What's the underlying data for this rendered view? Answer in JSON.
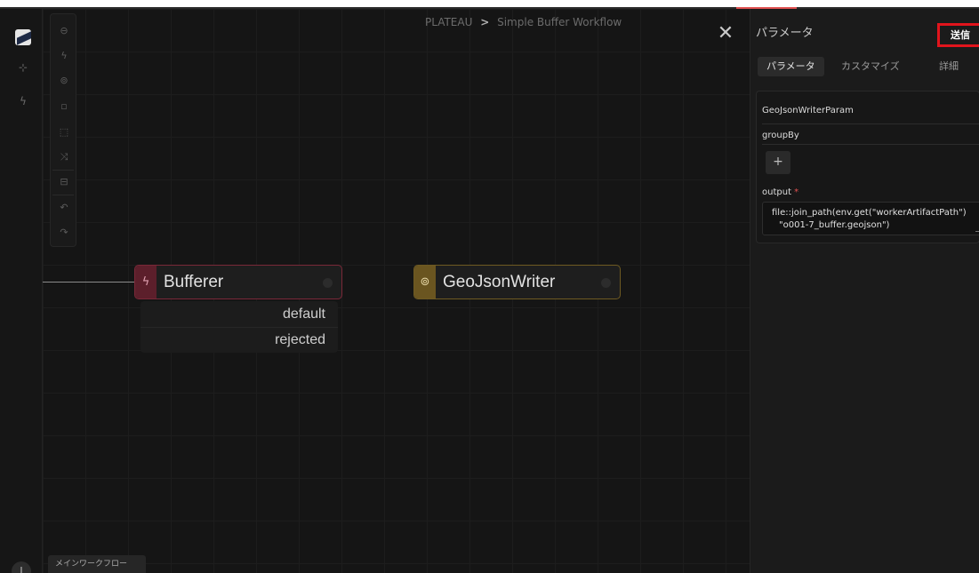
{
  "colors": {
    "background": "#141414",
    "panel": "#1b1b1b",
    "submit_outline": "#e1141c",
    "bufferer_accent": "#7a2838",
    "writer_accent": "#6e5a22",
    "active_indicator": "#e05151"
  },
  "sidebar": {
    "items": [
      {
        "icon": "layer-tree-icon"
      },
      {
        "icon": "lightning-icon"
      }
    ],
    "user_initial": "J"
  },
  "canvas_toolbar": {
    "items": [
      {
        "icon": "reader-icon"
      },
      {
        "icon": "transformer-icon"
      },
      {
        "icon": "writer-icon"
      },
      {
        "icon": "note-icon"
      },
      {
        "icon": "batch-icon"
      },
      {
        "icon": "subworkflow-icon"
      },
      {
        "icon": "layout-icon"
      },
      {
        "icon": "undo-icon"
      },
      {
        "icon": "redo-icon"
      }
    ]
  },
  "breadcrumb": {
    "project": "PLATEAU",
    "separator": ">",
    "workflow": "Simple Buffer Workflow"
  },
  "nodes": {
    "bufferer": {
      "icon": "lightning-icon",
      "label": "Bufferer",
      "ports": [
        "default",
        "rejected"
      ]
    },
    "geojson_writer": {
      "icon": "disc-icon",
      "label": "GeoJsonWriter"
    }
  },
  "workflow_tab": "メインワークフロー",
  "panel": {
    "title": "パラメータ",
    "submit_label": "送信",
    "tabs": [
      "パラメータ",
      "カスタマイズ",
      "詳細"
    ],
    "active_tab": "パラメータ",
    "form": {
      "schema_title": "GeoJsonWriterParam",
      "group_by_label": "groupBy",
      "add_label": "+",
      "output_label": "output",
      "required_mark": "*",
      "output_line1": "file::join_path(env.get(\"workerArtifactPath\")",
      "output_line2": "\"o001-7_buffer.geojson\")"
    }
  }
}
